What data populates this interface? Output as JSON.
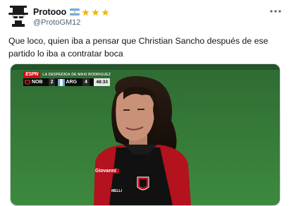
{
  "tweet": {
    "display_name": "Protooo",
    "handle": "@ProtoGM12",
    "text": "Que loco, quien iba a pensar que Christian Sancho después de ese partido lo iba a contratar boca",
    "badges": [
      "argentina-flag-icon",
      "star-icon",
      "star-icon",
      "star-icon"
    ],
    "accent_color": "#f2b705"
  },
  "media": {
    "scorebug": {
      "network": "ESPN",
      "title": "LA DESPEDIDA DE MAXI RODRIGUEZ",
      "home_team": "NOB",
      "home_score": "2",
      "away_team": "ARG",
      "away_score": "4",
      "clock": "48:33"
    },
    "jersey_sponsor": "Giovanni",
    "jersey_small_text": "MELLI"
  }
}
